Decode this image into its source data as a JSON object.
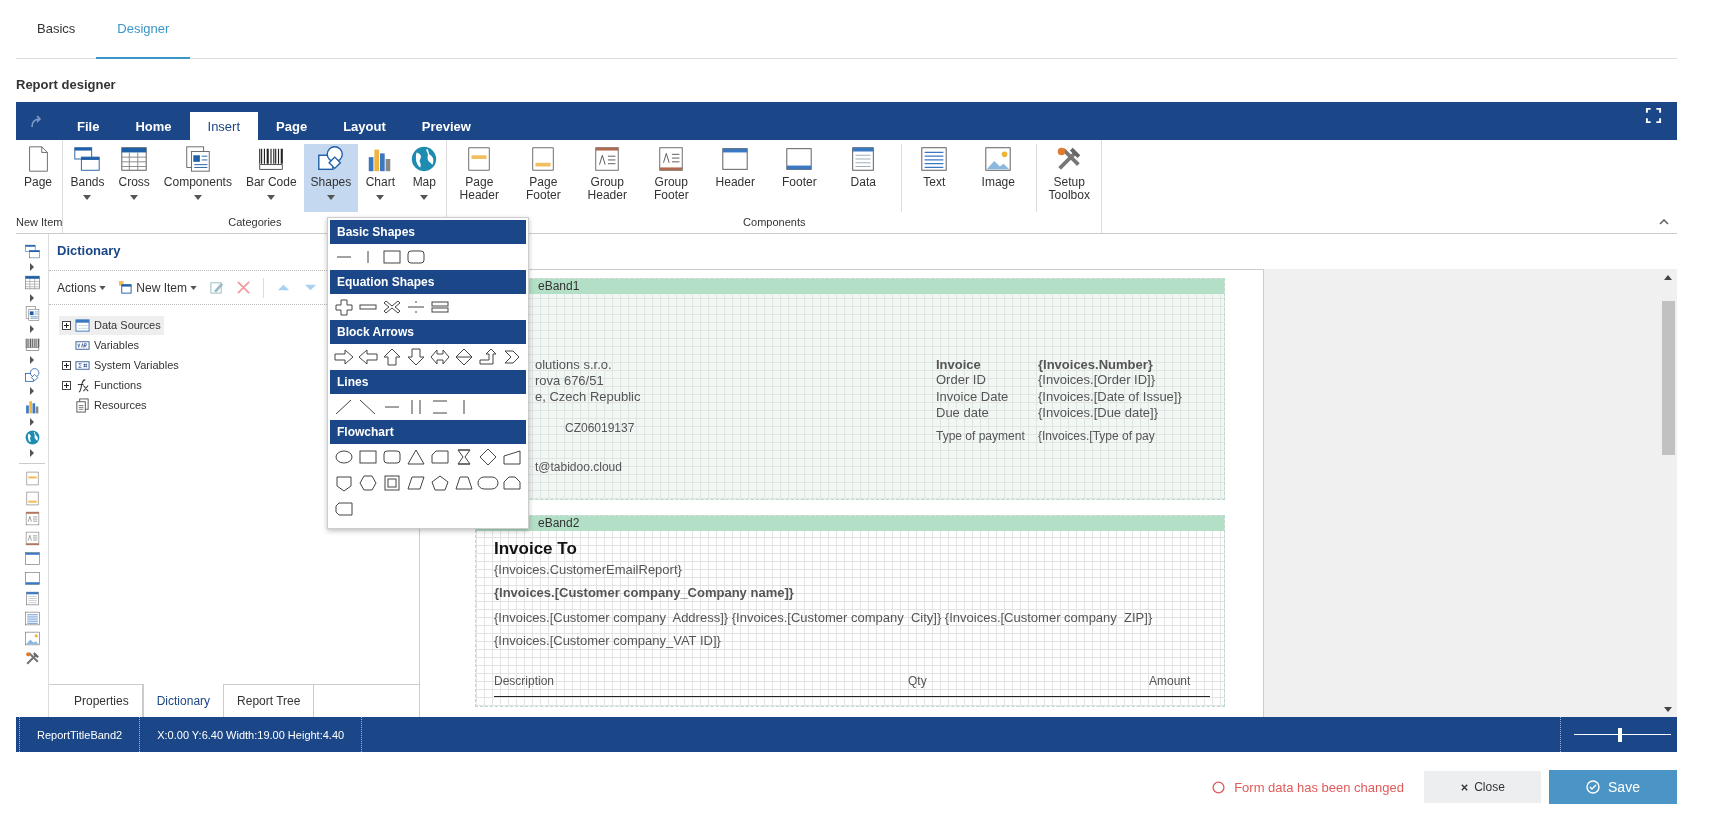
{
  "page_tabs": [
    {
      "label": "Basics",
      "selected": false
    },
    {
      "label": "Designer",
      "selected": true
    }
  ],
  "section_title": "Report designer",
  "ribbon": {
    "tabs": [
      {
        "label": "File",
        "selected": false
      },
      {
        "label": "Home",
        "selected": false
      },
      {
        "label": "Insert",
        "selected": true
      },
      {
        "label": "Page",
        "selected": false
      },
      {
        "label": "Layout",
        "selected": false
      },
      {
        "label": "Preview",
        "selected": false
      }
    ],
    "groups": [
      {
        "title": "New Item",
        "items": [
          {
            "label": "Page",
            "dropdown": false,
            "selected": false,
            "divider": false
          }
        ]
      },
      {
        "title": "Categories",
        "items": [
          {
            "label": "Bands",
            "dropdown": true,
            "selected": false,
            "divider": false
          },
          {
            "label": "Cross",
            "dropdown": true,
            "selected": false,
            "divider": false
          },
          {
            "label": "Components",
            "dropdown": true,
            "selected": false,
            "divider": false
          },
          {
            "label": "Bar Code",
            "dropdown": true,
            "selected": false,
            "divider": false
          },
          {
            "label": "Shapes",
            "dropdown": true,
            "selected": true,
            "divider": false
          },
          {
            "label": "Chart",
            "dropdown": true,
            "selected": false,
            "divider": false
          },
          {
            "label": "Map",
            "dropdown": true,
            "selected": false,
            "divider": false
          }
        ]
      },
      {
        "title": "Components",
        "items": [
          {
            "label": "Page Header",
            "dropdown": false,
            "selected": false,
            "divider": false
          },
          {
            "label": "Page Footer",
            "dropdown": false,
            "selected": false,
            "divider": false
          },
          {
            "label": "Group Header",
            "dropdown": false,
            "selected": false,
            "divider": false
          },
          {
            "label": "Group Footer",
            "dropdown": false,
            "selected": false,
            "divider": false
          },
          {
            "label": "Header",
            "dropdown": false,
            "selected": false,
            "divider": false
          },
          {
            "label": "Footer",
            "dropdown": false,
            "selected": false,
            "divider": false
          },
          {
            "label": "Data",
            "dropdown": false,
            "selected": false,
            "divider": false
          },
          {
            "label": "Text",
            "dropdown": false,
            "selected": false,
            "divider": true
          },
          {
            "label": "Image",
            "dropdown": false,
            "selected": false,
            "divider": false
          },
          {
            "label": "Setup Toolbox",
            "dropdown": false,
            "selected": false,
            "divider": true
          }
        ]
      }
    ]
  },
  "shapes_menu": [
    {
      "title": "Basic Shapes"
    },
    {
      "title": "Equation Shapes"
    },
    {
      "title": "Block Arrows"
    },
    {
      "title": "Lines"
    },
    {
      "title": "Flowchart"
    }
  ],
  "dictionary": {
    "title": "Dictionary",
    "toolbar": [
      {
        "label": "Actions",
        "kind": "menu"
      },
      {
        "label": "New Item",
        "kind": "menu"
      }
    ],
    "tree": [
      {
        "label": "Data Sources",
        "expandable": true,
        "selected": true
      },
      {
        "label": "Variables",
        "expandable": false,
        "selected": false
      },
      {
        "label": "System Variables",
        "expandable": true,
        "selected": false
      },
      {
        "label": "Functions",
        "expandable": true,
        "selected": false
      },
      {
        "label": "Resources",
        "expandable": false,
        "selected": false
      }
    ],
    "tabs": [
      {
        "label": "Properties",
        "selected": false
      },
      {
        "label": "Dictionary",
        "selected": true
      },
      {
        "label": "Report Tree",
        "selected": false
      }
    ]
  },
  "report": {
    "bands": [
      {
        "title": "eBand1"
      },
      {
        "title": "eBand2"
      }
    ],
    "fields": [
      {
        "text": "olutions s.r.o."
      },
      {
        "text": "rova 676/51"
      },
      {
        "text": "e, Czech Republic"
      },
      {
        "text": "CZ06019137"
      },
      {
        "text": "t@tabidoo.cloud"
      },
      {
        "text": "Invoice"
      },
      {
        "text": "Order ID"
      },
      {
        "text": "Invoice Date"
      },
      {
        "text": "Due date"
      },
      {
        "text": "Type of payment"
      },
      {
        "text": "{Invoices.Number}"
      },
      {
        "text": "{Invoices.[Order ID]}"
      },
      {
        "text": "{Invoices.[Date of Issue]}"
      },
      {
        "text": "{Invoices.[Due date]}"
      },
      {
        "text": "{Invoices.[Type of pay"
      },
      {
        "text": "Invoice To"
      },
      {
        "text": "{Invoices.CustomerEmailReport}"
      },
      {
        "text": "{Invoices.[Customer company_Company name]}"
      },
      {
        "text": "{Invoices.[Customer company  Address]} {Invoices.[Customer company  City]} {Invoices.[Customer company  ZIP]}"
      },
      {
        "text": "{Invoices.[Customer company_VAT ID]}"
      },
      {
        "text": "Description"
      },
      {
        "text": "Qty"
      },
      {
        "text": "Amount"
      }
    ]
  },
  "status_bar": {
    "component": "ReportTitleBand2",
    "position": "X:0.00 Y:6.40 Width:19.00 Height:4.40",
    "zoom": {
      "level": 0.47
    }
  },
  "footer": {
    "notice": "Form data has been changed",
    "close": "Close",
    "save": "Save"
  }
}
